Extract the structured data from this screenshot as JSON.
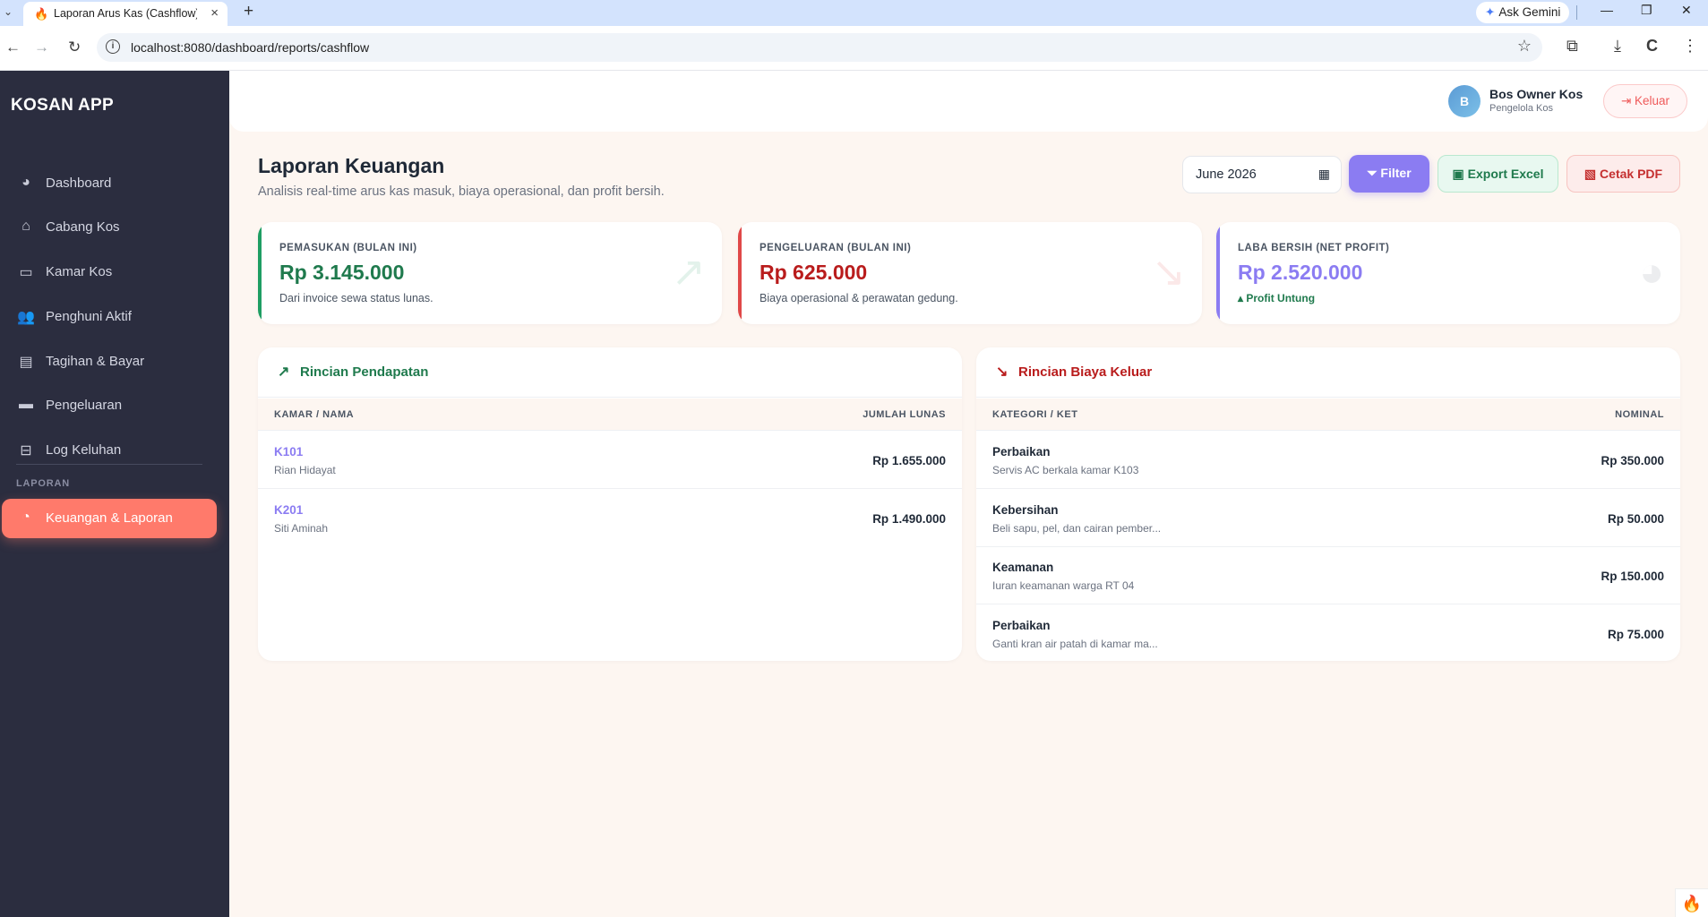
{
  "browser": {
    "tab_title": "Laporan Arus Kas (Cashflow) - K",
    "url": "localhost:8080/dashboard/reports/cashflow",
    "gemini_label": "Ask Gemini"
  },
  "sidebar": {
    "brand": "KOSAN APP",
    "items": [
      {
        "label": "Dashboard",
        "icon": "palette-icon"
      },
      {
        "label": "Cabang Kos",
        "icon": "home-icon"
      },
      {
        "label": "Kamar Kos",
        "icon": "bed-icon"
      },
      {
        "label": "Penghuni Aktif",
        "icon": "users-icon"
      },
      {
        "label": "Tagihan & Bayar",
        "icon": "invoice-icon"
      },
      {
        "label": "Pengeluaran",
        "icon": "wallet-icon"
      },
      {
        "label": "Log Keluhan",
        "icon": "inbox-icon"
      }
    ],
    "section_label": "LAPORAN",
    "active_item": {
      "label": "Keuangan & Laporan",
      "icon": "chart-pie-icon"
    }
  },
  "header": {
    "avatar_initial": "B",
    "user_name": "Bos Owner Kos",
    "user_role": "Pengelola Kos",
    "logout_label": "Keluar"
  },
  "page": {
    "title": "Laporan Keuangan",
    "subtitle": "Analisis real-time arus kas masuk, biaya operasional, dan profit bersih.",
    "month_value": "June 2026",
    "filter_label": "Filter",
    "export_label": "Export Excel",
    "pdf_label": "Cetak PDF"
  },
  "stats": [
    {
      "label": "PEMASUKAN (BULAN INI)",
      "value": "Rp 3.145.000",
      "note": "Dari invoice sewa status lunas.",
      "color": "#1f7a4d",
      "icon": "trend-up-icon"
    },
    {
      "label": "PENGELUARAN (BULAN INI)",
      "value": "Rp 625.000",
      "note": "Biaya operasional & perawatan gedung.",
      "color": "#b91c1c",
      "icon": "trend-down-icon"
    },
    {
      "label": "LABA BERSIH (NET PROFIT)",
      "value": "Rp 2.520.000",
      "note": "Profit Untung",
      "color": "#8b7cf2",
      "icon": "chart-pie-icon"
    }
  ],
  "income": {
    "title": "Rincian Pendapatan",
    "col_left": "KAMAR / NAMA",
    "col_right": "JUMLAH LUNAS",
    "rows": [
      {
        "room": "K101",
        "name": "Rian Hidayat",
        "amount": "Rp 1.655.000"
      },
      {
        "room": "K201",
        "name": "Siti Aminah",
        "amount": "Rp 1.490.000"
      }
    ]
  },
  "expense": {
    "title": "Rincian Biaya Keluar",
    "col_left": "KATEGORI / KET",
    "col_right": "NOMINAL",
    "rows": [
      {
        "category": "Perbaikan",
        "desc": "Servis AC berkala kamar K103",
        "amount": "Rp 350.000"
      },
      {
        "category": "Kebersihan",
        "desc": "Beli sapu, pel, dan cairan pember...",
        "amount": "Rp 50.000"
      },
      {
        "category": "Keamanan",
        "desc": "Iuran keamanan warga RT 04",
        "amount": "Rp 150.000"
      },
      {
        "category": "Perbaikan",
        "desc": "Ganti kran air patah di kamar ma...",
        "amount": "Rp 75.000"
      }
    ]
  },
  "colors": {
    "sidebar_bg": "#2b2d3f",
    "active_nav": "#ff7a6b",
    "income_green": "#1f7a4d",
    "expense_red": "#b91c1c",
    "profit_purple": "#8b7cf2",
    "room_link": "#8b7cf2"
  }
}
